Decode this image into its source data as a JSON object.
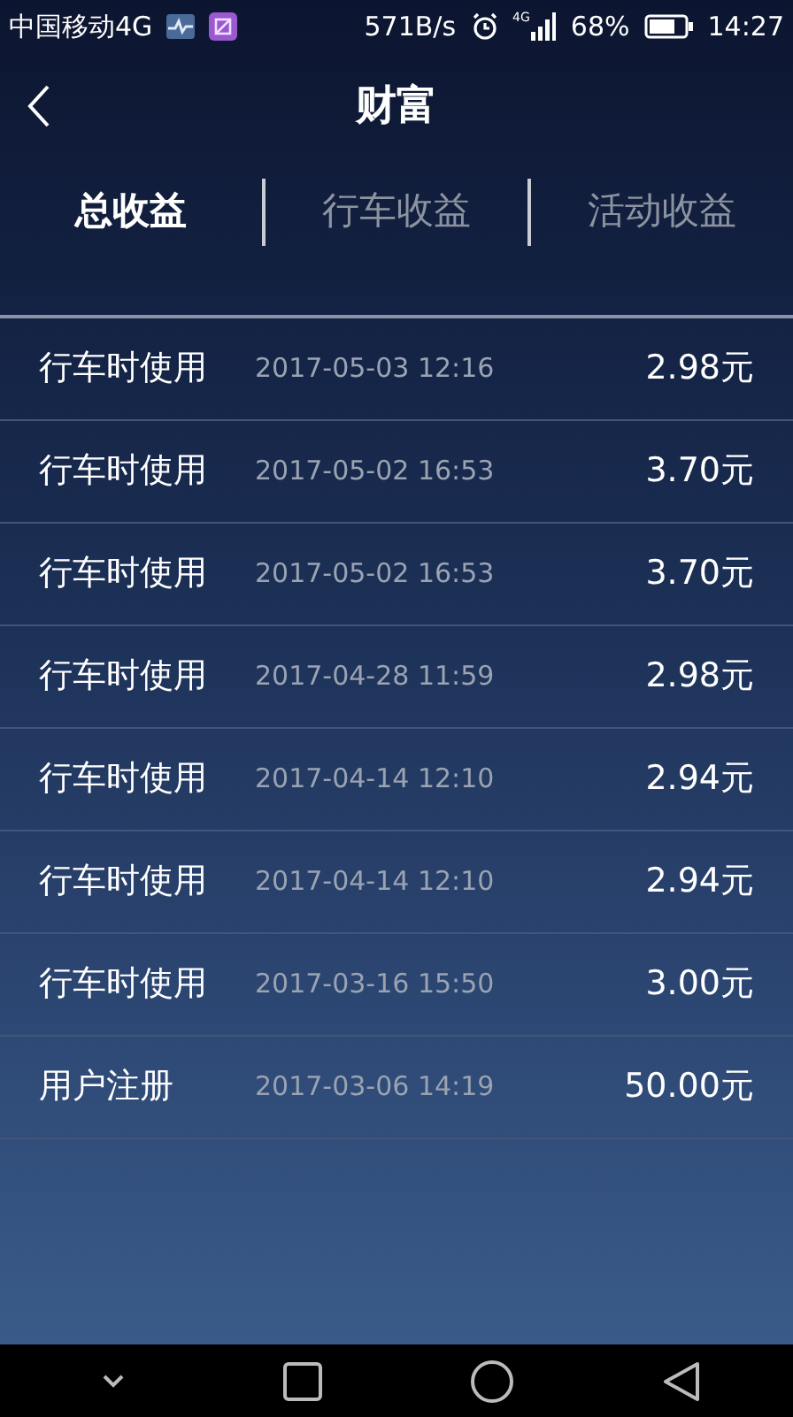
{
  "status_bar": {
    "carrier": "中国移动4G",
    "speed": "571B/s",
    "signal_label": "4G",
    "battery": "68%",
    "time": "14:27"
  },
  "header": {
    "title": "财富"
  },
  "tabs": [
    {
      "label": "总收益",
      "selected": true
    },
    {
      "label": "行车收益",
      "selected": false
    },
    {
      "label": "活动收益",
      "selected": false
    }
  ],
  "records": [
    {
      "name": "行车时使用",
      "time": "2017-05-03 12:16",
      "amount": "2.98元"
    },
    {
      "name": "行车时使用",
      "time": "2017-05-02 16:53",
      "amount": "3.70元"
    },
    {
      "name": "行车时使用",
      "time": "2017-05-02 16:53",
      "amount": "3.70元"
    },
    {
      "name": "行车时使用",
      "time": "2017-04-28 11:59",
      "amount": "2.98元"
    },
    {
      "name": "行车时使用",
      "time": "2017-04-14 12:10",
      "amount": "2.94元"
    },
    {
      "name": "行车时使用",
      "time": "2017-04-14 12:10",
      "amount": "2.94元"
    },
    {
      "name": "行车时使用",
      "time": "2017-03-16 15:50",
      "amount": "3.00元"
    },
    {
      "name": "用户注册",
      "time": "2017-03-06 14:19",
      "amount": "50.00元"
    }
  ]
}
